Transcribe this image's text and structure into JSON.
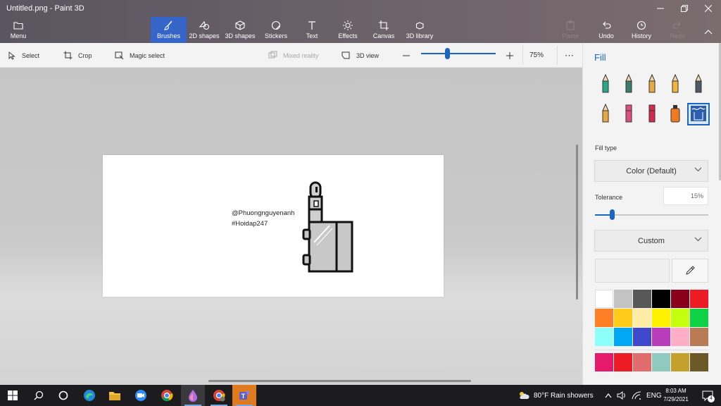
{
  "window": {
    "title": "Untitled.png - Paint 3D",
    "controls": [
      "minimize",
      "maximize",
      "close"
    ]
  },
  "ribbon": {
    "menu_label": "Menu",
    "tabs": [
      {
        "label": "Brushes",
        "icon": "brush-icon",
        "active": true
      },
      {
        "label": "2D shapes",
        "icon": "2d-shapes-icon"
      },
      {
        "label": "3D shapes",
        "icon": "3d-cube-icon"
      },
      {
        "label": "Stickers",
        "icon": "sticker-icon"
      },
      {
        "label": "Text",
        "icon": "text-icon"
      },
      {
        "label": "Effects",
        "icon": "sun-effects-icon"
      },
      {
        "label": "Canvas",
        "icon": "canvas-crop-icon"
      },
      {
        "label": "3D library",
        "icon": "library-cubes-icon"
      }
    ],
    "actions": [
      {
        "label": "Paste",
        "icon": "paste-icon",
        "enabled": false
      },
      {
        "label": "Undo",
        "icon": "undo-icon",
        "enabled": true
      },
      {
        "label": "History",
        "icon": "history-clock-icon",
        "enabled": true
      },
      {
        "label": "Redo",
        "icon": "redo-icon",
        "enabled": false
      }
    ]
  },
  "toolbar": {
    "select": "Select",
    "crop": "Crop",
    "magic_select": "Magic select",
    "mixed_reality": "Mixed reality",
    "view_3d": "3D view",
    "zoom_level": "75%",
    "zoom_fraction": 0.35
  },
  "canvas": {
    "lines": [
      "@Phuongnguyenanh",
      "#Hoidap247"
    ]
  },
  "panel": {
    "title": "Fill",
    "brushes": [
      {
        "icon": "marker-icon",
        "color": "#2aa58a"
      },
      {
        "icon": "calligraphy-pen-icon",
        "color": "#3a7d6c"
      },
      {
        "icon": "oil-brush-icon",
        "color": "#e8a844"
      },
      {
        "icon": "watercolor-brush-icon",
        "color": "#f2b43a"
      },
      {
        "icon": "pixel-pen-icon",
        "color": "#4d5966"
      },
      {
        "icon": "pencil-icon",
        "color": "#e8a844"
      },
      {
        "icon": "eraser-icon",
        "color": "#e0507a"
      },
      {
        "icon": "crayon-icon",
        "color": "#d8284e"
      },
      {
        "icon": "spray-can-icon",
        "color": "#f07a20"
      },
      {
        "icon": "fill-bucket-icon",
        "color": "#2b5fae",
        "selected": true
      }
    ],
    "fill_type_label": "Fill type",
    "fill_type_value": "Color (Default)",
    "tolerance_label": "Tolerance",
    "tolerance_value": "15%",
    "tolerance_fraction": 0.15,
    "custom_label": "Custom",
    "eyedropper_icon": "eyedropper-icon",
    "palette": [
      "#ffffff",
      "#c3c3c3",
      "#585858",
      "#000000",
      "#88001b",
      "#ec1c24",
      "#ff7f27",
      "#ffca18",
      "#fdeca6",
      "#fff200",
      "#c4ff0e",
      "#0ed145",
      "#8cfffb",
      "#00a8f3",
      "#3f48cc",
      "#b83dba",
      "#ffaec8",
      "#b97a56",
      "#e6196b",
      "#ed1c24",
      "#e06c6c",
      "#8fc9c0",
      "#c4a02c",
      "#6b5a28"
    ]
  },
  "taskbar": {
    "weather": "80°F  Rain showers",
    "language": "ENG",
    "time": "8:03 AM",
    "date": "7/29/2021",
    "notification_count": "4"
  }
}
